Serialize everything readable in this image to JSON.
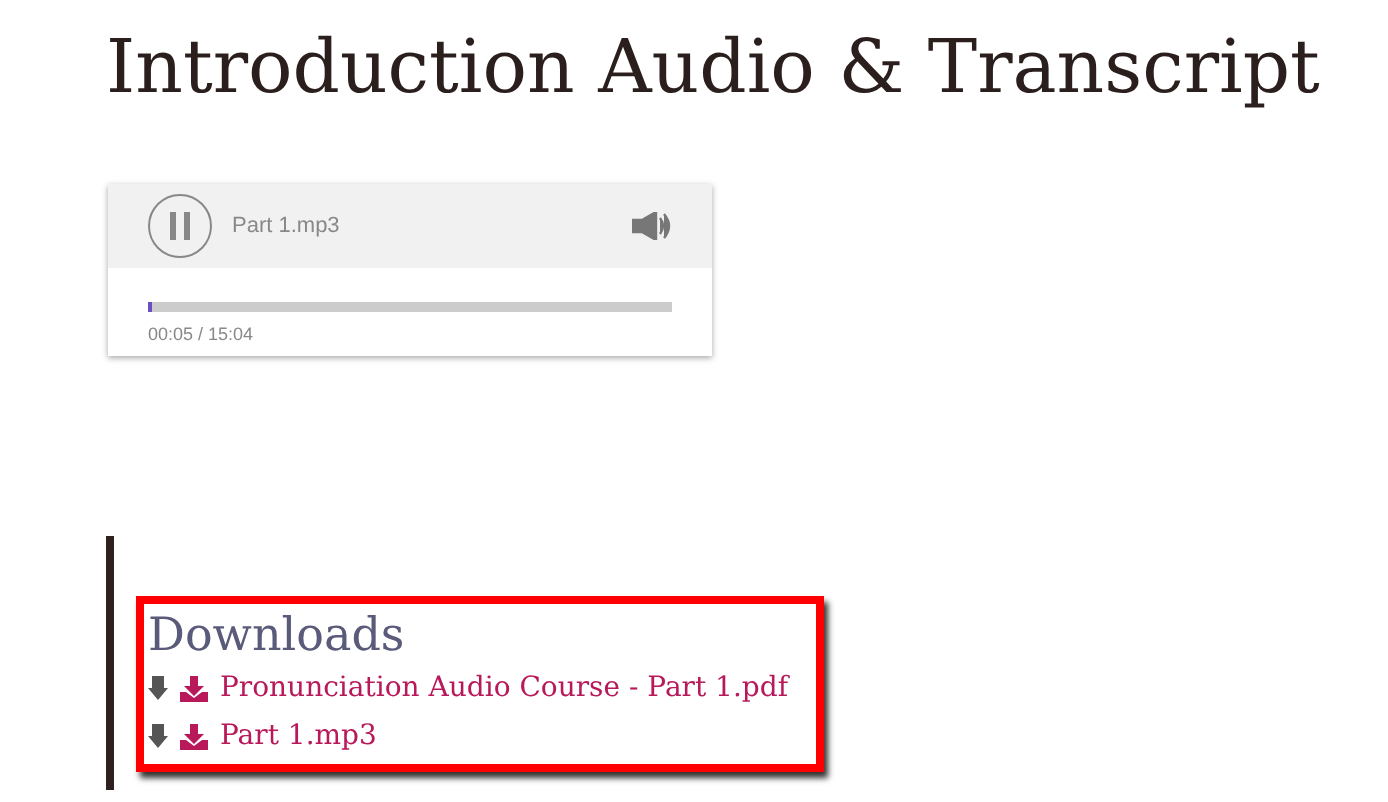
{
  "title": "Introduction Audio & Transcript",
  "player": {
    "playing": true,
    "file": "Part 1.mp3",
    "level": 0.006,
    "time": "00:05 / 15:04"
  },
  "downloads": {
    "heading": "Downloads",
    "highlighted": true,
    "items": [
      {
        "label": "Pronunciation Audio Course - Part 1.pdf"
      },
      {
        "label": "Part 1.mp3"
      }
    ]
  }
}
